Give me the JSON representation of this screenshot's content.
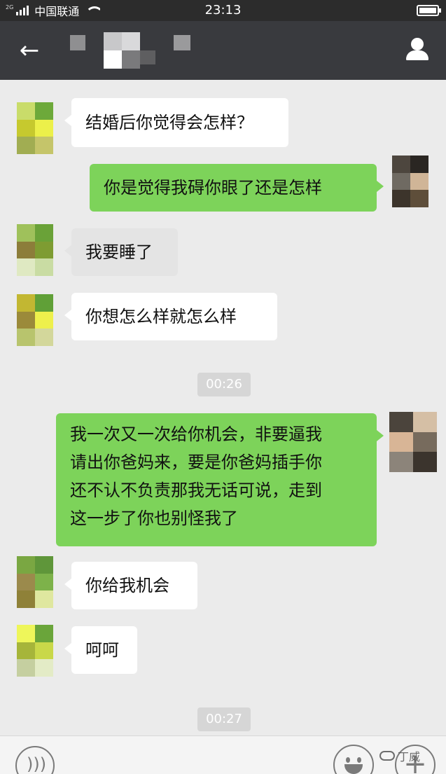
{
  "status_bar": {
    "network": "2G",
    "carrier": "中国联通",
    "time": "23:13"
  },
  "header": {
    "back_icon": "arrow-left-icon",
    "contact_icon": "person-icon"
  },
  "messages": [
    {
      "side": "in",
      "text": "结婚后你觉得会怎样？"
    },
    {
      "side": "out",
      "text": "你是觉得我碍你眼了还是怎样"
    },
    {
      "side": "in",
      "text": "我要睡了"
    },
    {
      "side": "in",
      "text": "你想怎么样就怎么样"
    },
    {
      "timestamp": "00:26"
    },
    {
      "side": "out",
      "lines": [
        "我一次又一次给你机会，非要逼我",
        "请出你爸妈来，要是你爸妈插手你",
        "还不认不负责那我无话可说，走到",
        "这一步了你也别怪我了"
      ]
    },
    {
      "side": "in",
      "text": "你给我机会"
    },
    {
      "side": "in",
      "text": "呵呵"
    },
    {
      "timestamp": "00:27"
    }
  ],
  "bottom_bar": {
    "voice_icon": "voice-icon",
    "emoji_icon": "emoji-icon",
    "more_icon": "plus-icon",
    "watermark": "丁威"
  },
  "colors": {
    "header_bg": "#393a3e",
    "chat_bg": "#ebebeb",
    "sent_bubble": "#7dd35a",
    "received_bubble": "#ffffff",
    "timestamp_bg": "#d6d6d6"
  }
}
